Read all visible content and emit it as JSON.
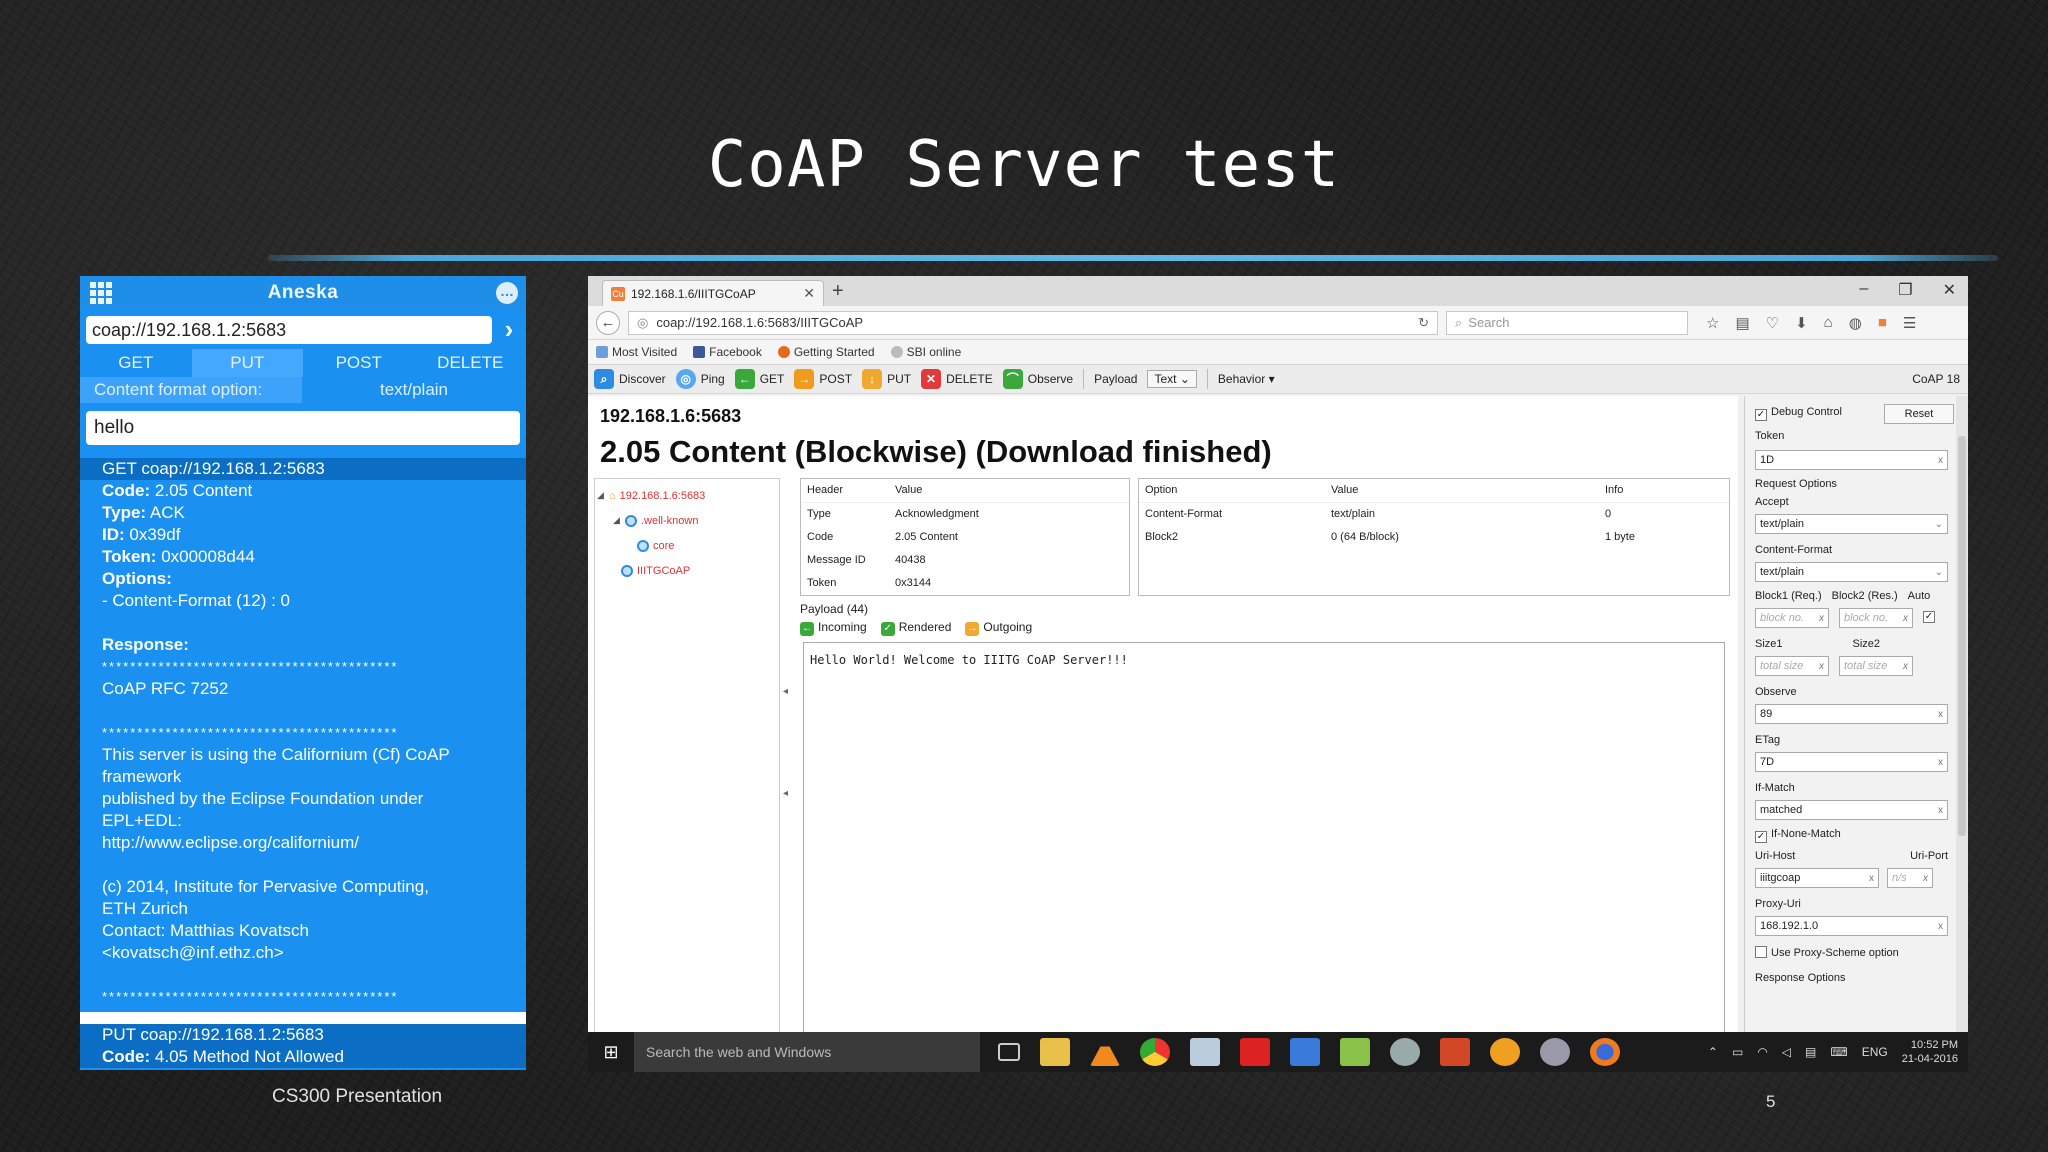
{
  "slide": {
    "title": "CoAP Server test",
    "footer_left": "CS300 Presentation",
    "page_number": "5"
  },
  "phone": {
    "app_name": "Aneska",
    "url": "coap://192.168.1.2:5683",
    "methods": [
      "GET",
      "PUT",
      "POST",
      "DELETE"
    ],
    "active_method": "PUT",
    "content_format_label": "Content format option:",
    "content_format_value": "text/plain",
    "payload": "hello",
    "log1_header": "GET coap://192.168.1.2:5683",
    "code_label": "Code:",
    "code_value": " 2.05 Content",
    "type_label": "Type:",
    "type_value": " ACK",
    "id_label": "ID:",
    "id_value": " 0x39df",
    "token_label": "Token:",
    "token_value": " 0x00008d44",
    "options_label": "Options:",
    "options_value": "- Content-Format (12) : 0",
    "response_label": "Response:",
    "stars": "******************************************",
    "rfc": "CoAP RFC 7252",
    "body": [
      "This server is using the Californium (Cf) CoAP",
      "framework",
      "published by the Eclipse Foundation under",
      "EPL+EDL:",
      "http://www.eclipse.org/californium/",
      "",
      "(c) 2014, Institute for Pervasive Computing,",
      "ETH Zurich",
      "Contact: Matthias Kovatsch",
      "<kovatsch@inf.ethz.ch>"
    ],
    "log2_header": "PUT coap://192.168.1.2:5683",
    "log2_code_value": " 4.05 Method Not Allowed"
  },
  "browser": {
    "tab_title": "192.168.1.6/IIITGCoAP",
    "url": "coap://192.168.1.6:5683/IIITGCoAP",
    "search_placeholder": "Search",
    "bookmarks": [
      "Most Visited",
      "Facebook",
      "Getting Started",
      "SBI online"
    ],
    "toolbar": {
      "discover": "Discover",
      "ping": "Ping",
      "get": "GET",
      "post": "POST",
      "put": "PUT",
      "delete": "DELETE",
      "observe": "Observe",
      "payload": "Payload",
      "payload_mode": "Text",
      "behavior": "Behavior",
      "version": "CoAP 18"
    },
    "host": "192.168.1.6:5683",
    "status": "2.05 Content (Blockwise) (Download finished)",
    "tree": [
      "192.168.1.6:5683",
      ".well-known",
      "core",
      "IIITGCoAP"
    ],
    "header_table": {
      "columns": [
        "Header",
        "Value"
      ],
      "rows": [
        [
          "Type",
          "Acknowledgment"
        ],
        [
          "Code",
          "2.05 Content"
        ],
        [
          "Message ID",
          "40438"
        ],
        [
          "Token",
          "0x3144"
        ]
      ]
    },
    "option_table": {
      "columns": [
        "Option",
        "Value",
        "Info"
      ],
      "rows": [
        [
          "Content-Format",
          "text/plain",
          "0"
        ],
        [
          "Block2",
          "0 (64 B/block)",
          "1 byte"
        ]
      ]
    },
    "payload_label": "Payload (44)",
    "payload_tabs": [
      "Incoming",
      "Rendered",
      "Outgoing"
    ],
    "payload_text": "Hello World! Welcome to IIITG CoAP Server!!!",
    "side": {
      "debug_control": "Debug Control",
      "reset": "Reset",
      "token_label": "Token",
      "token_value": "1D",
      "request_options": "Request Options",
      "accept_label": "Accept",
      "accept_value": "text/plain",
      "content_format_label": "Content-Format",
      "content_format_value": "text/plain",
      "block1_label": "Block1 (Req.)",
      "block2_label": "Block2 (Res.)",
      "auto_label": "Auto",
      "block_placeholder": "block no.",
      "size1_label": "Size1",
      "size2_label": "Size2",
      "size_placeholder": "total size",
      "observe_label": "Observe",
      "observe_value": "89",
      "etag_label": "ETag",
      "etag_value": "7D",
      "ifmatch_label": "If-Match",
      "ifmatch_value": "matched",
      "ifnonematch_label": "If-None-Match",
      "urihost_label": "Uri-Host",
      "urihost_value": "iiitgcoap",
      "uriport_label": "Uri-Port",
      "uriport_placeholder": "n/s",
      "proxyuri_label": "Proxy-Uri",
      "proxyuri_value": "168.192.1.0",
      "use_proxy_label": "Use Proxy-Scheme option",
      "response_options": "Response Options"
    }
  },
  "taskbar": {
    "search_placeholder": "Search the web and Windows",
    "lang": "ENG",
    "time": "10:52 PM",
    "date": "21-04-2016"
  }
}
